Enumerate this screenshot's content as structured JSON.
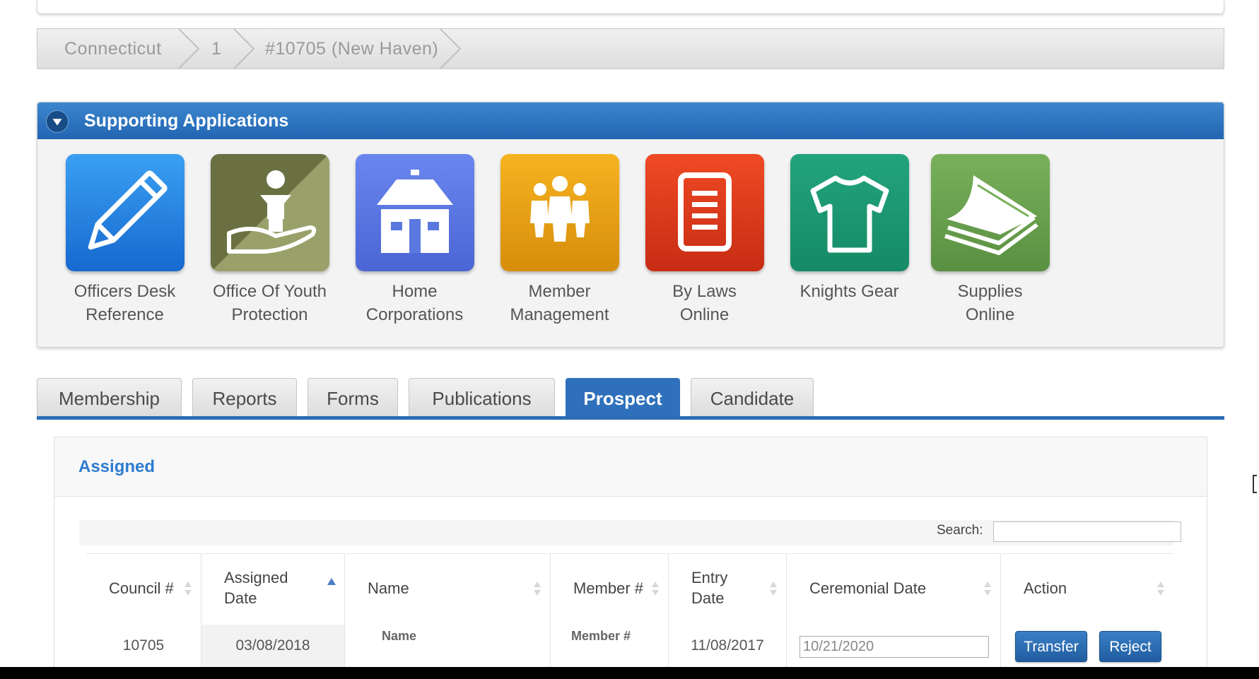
{
  "breadcrumb": {
    "items": [
      "Connecticut",
      "1",
      "#10705 (New Haven)"
    ]
  },
  "supporting_apps": {
    "title": "Supporting Applications",
    "apps": [
      {
        "line1": "Officers Desk",
        "line2": "Reference",
        "icon": "pencil-icon",
        "color": "#1e88e5"
      },
      {
        "line1": "Office Of Youth",
        "line2": "Protection",
        "icon": "youth-protection-icon",
        "color": "#8a8f5c"
      },
      {
        "line1": "Home",
        "line2": "Corporations",
        "icon": "house-icon",
        "color": "#5b78e0"
      },
      {
        "line1": "Member",
        "line2": "Management",
        "icon": "people-group-icon",
        "color": "#e8a413"
      },
      {
        "line1": "By Laws",
        "line2": "Online",
        "icon": "document-icon",
        "color": "#dd3a1f"
      },
      {
        "line1": "Knights Gear",
        "line2": "",
        "icon": "tshirt-icon",
        "color": "#1e9a74"
      },
      {
        "line1": "Supplies",
        "line2": "Online",
        "icon": "paper-stack-icon",
        "color": "#6ca24f"
      }
    ]
  },
  "tabs": {
    "items": [
      "Membership",
      "Reports",
      "Forms",
      "Publications",
      "Prospect",
      "Candidate"
    ],
    "active": "Prospect"
  },
  "assigned": {
    "title": "Assigned",
    "search_label": "Search:",
    "search_value": "",
    "columns": {
      "council": "Council #",
      "assigned_1": "Assigned",
      "assigned_2": "Date",
      "name": "Name",
      "member": "Member #",
      "entry_1": "Entry",
      "entry_2": "Date",
      "ceremonial": "Ceremonial Date",
      "action": "Action"
    },
    "row": {
      "council": "10705",
      "assigned_date": "03/08/2018",
      "name": "Name",
      "member": "Member #",
      "entry_date": "11/08/2017",
      "ceremonial_date": "10/21/2020",
      "transfer": "Transfer",
      "reject": "Reject"
    }
  }
}
